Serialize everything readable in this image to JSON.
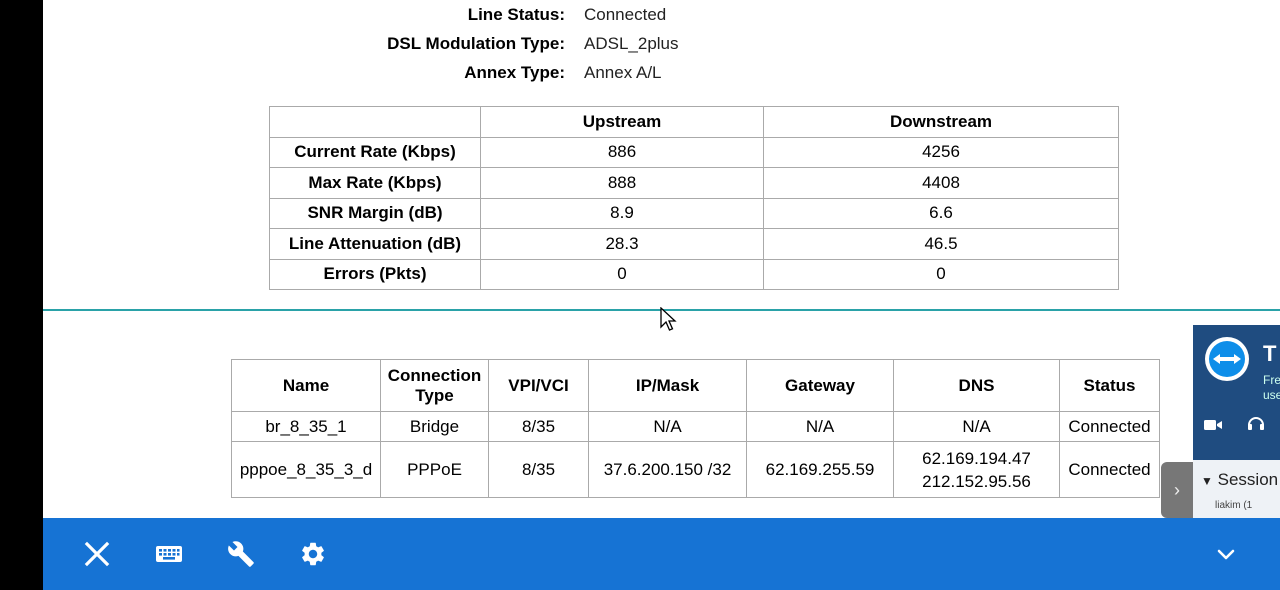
{
  "line_info": [
    {
      "label": "Line Status:",
      "value": "Connected"
    },
    {
      "label": "DSL Modulation Type:",
      "value": "ADSL_2plus"
    },
    {
      "label": "Annex Type:",
      "value": "Annex A/L"
    }
  ],
  "rate_table": {
    "headers": [
      "",
      "Upstream",
      "Downstream"
    ],
    "rows": [
      {
        "label": "Current Rate (Kbps)",
        "up": "886",
        "down": "4256"
      },
      {
        "label": "Max Rate (Kbps)",
        "up": "888",
        "down": "4408"
      },
      {
        "label": "SNR Margin (dB)",
        "up": "8.9",
        "down": "6.6"
      },
      {
        "label": "Line Attenuation (dB)",
        "up": "28.3",
        "down": "46.5"
      },
      {
        "label": "Errors (Pkts)",
        "up": "0",
        "down": "0"
      }
    ]
  },
  "wan_table": {
    "headers": {
      "name": "Name",
      "type_line1": "Connection",
      "type_line2": "Type",
      "vpivci": "VPI/VCI",
      "ip": "IP/Mask",
      "gateway": "Gateway",
      "dns": "DNS",
      "status": "Status"
    },
    "rows": [
      {
        "name": "br_8_35_1",
        "type": "Bridge",
        "vpivci": "8/35",
        "ip": "N/A",
        "gateway": "N/A",
        "dns1": "N/A",
        "dns2": "",
        "status": "Connected"
      },
      {
        "name": "pppoe_8_35_3_d",
        "type": "PPPoE",
        "vpivci": "8/35",
        "ip": "37.6.200.150 /32",
        "gateway": "62.169.255.59",
        "dns1": "62.169.194.47",
        "dns2": "212.152.95.56",
        "status": "Connected"
      }
    ]
  },
  "teamviewer": {
    "title": "T",
    "sub_line1": "Fre",
    "sub_line2": "use",
    "session_label": "Session",
    "session_user": "liakim (1"
  },
  "toolbar": {
    "icons": [
      "close-icon",
      "keyboard-icon",
      "wrench-icon",
      "gear-icon",
      "chevron-down-icon"
    ]
  },
  "colors": {
    "toolbar": "#1673d4",
    "divider": "#2aa2a8",
    "teamviewer_header": "#1f4c80"
  }
}
